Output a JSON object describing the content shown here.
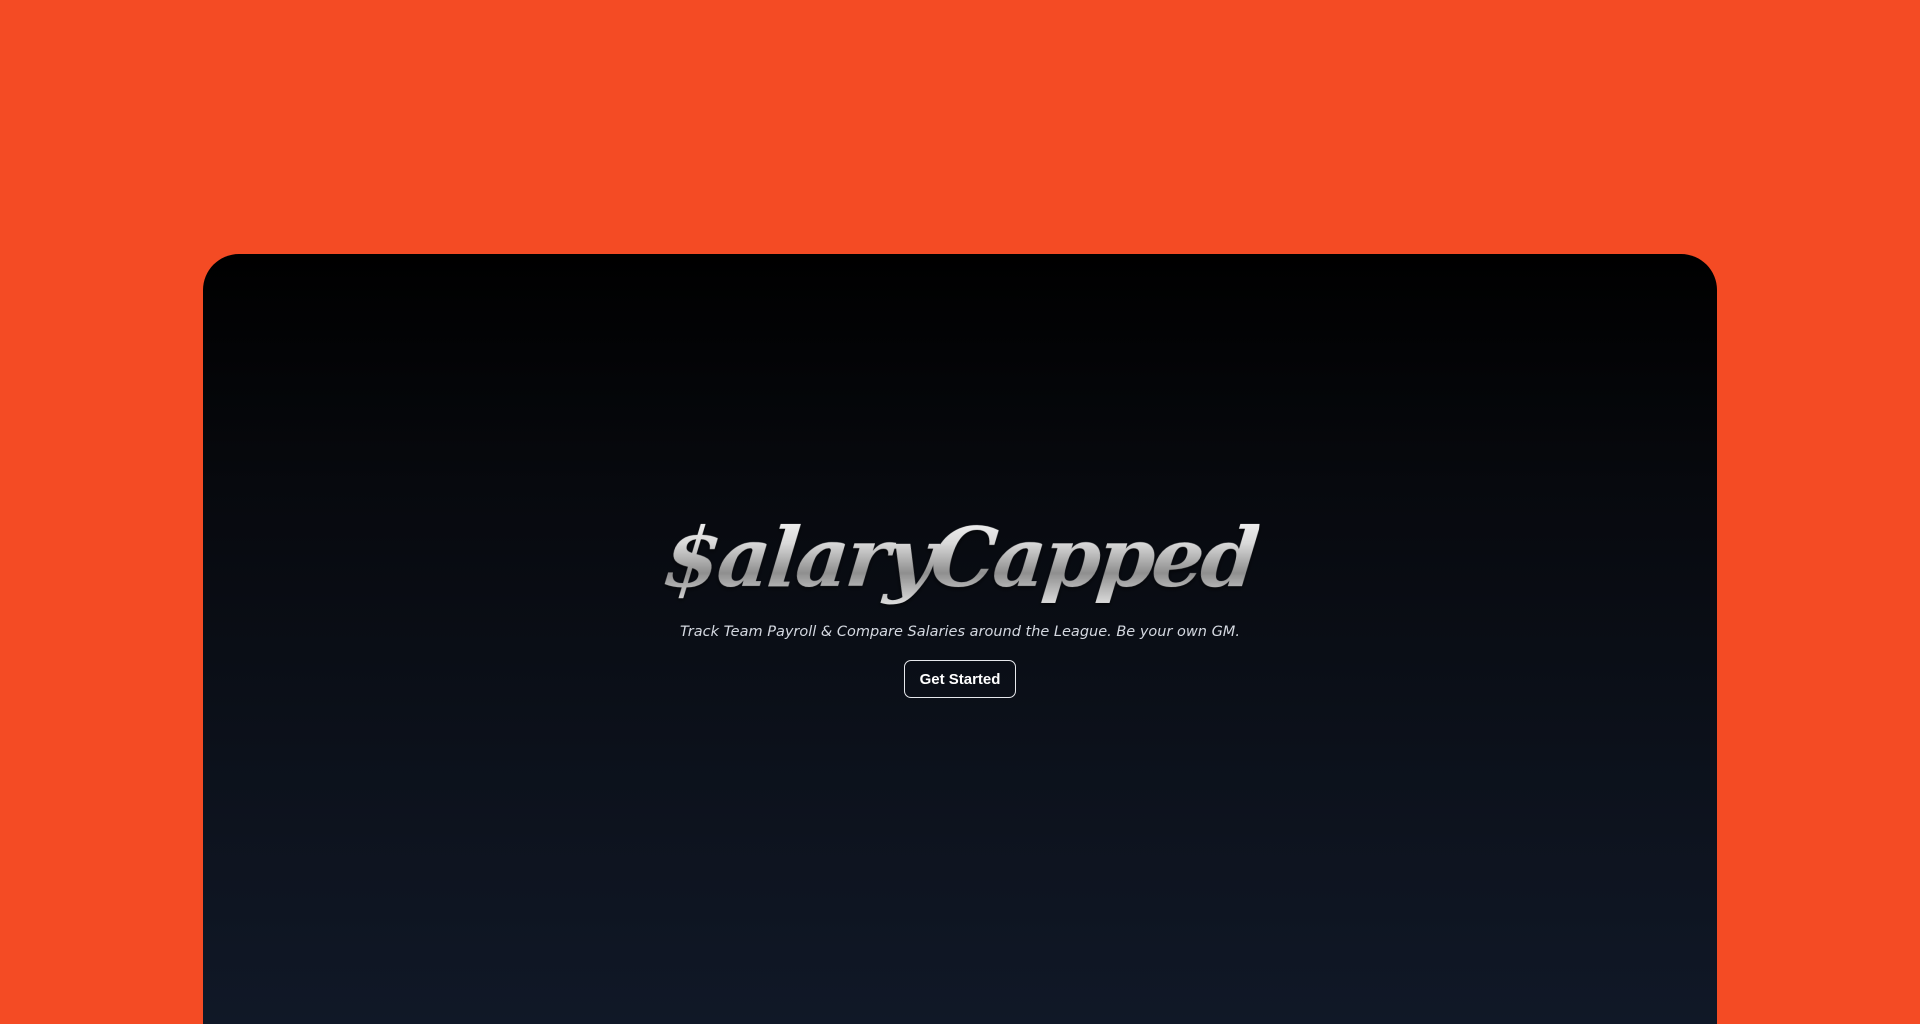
{
  "colors": {
    "background": "#f44b24",
    "window_top": "#000000",
    "window_bottom": "#101827",
    "tagline": "#d4d8e0",
    "button_border": "#e6e8ec"
  },
  "hero": {
    "logo": "$alaryCapped",
    "tagline": "Track Team Payroll & Compare Salaries around the League. Be your own GM.",
    "cta_label": "Get Started"
  }
}
